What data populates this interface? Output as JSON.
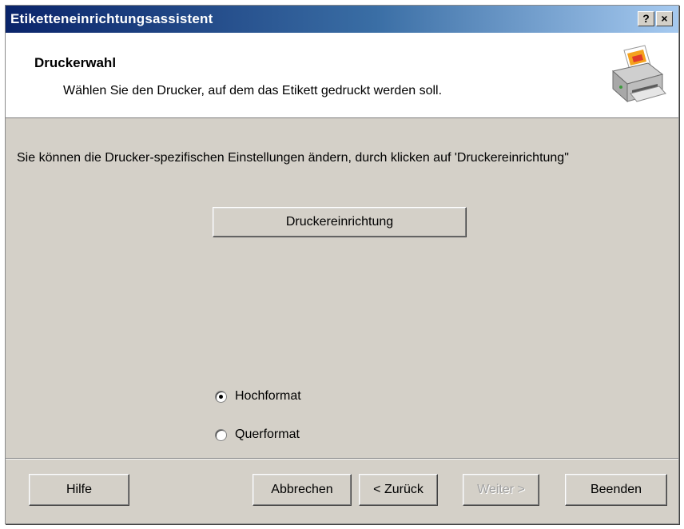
{
  "window": {
    "title": "Etiketteneinrichtungsassistent",
    "help_button": "?",
    "close_button": "×"
  },
  "header": {
    "title": "Druckerwahl",
    "description": "Wählen Sie den Drucker, auf dem das Etikett gedruckt werden soll.",
    "icon": "printer-icon"
  },
  "body": {
    "instruction": "Sie können die Drucker-spezifischen Einstellungen ändern, durch klicken auf 'Druckereinrichtung\"",
    "setup_button": "Druckereinrichtung"
  },
  "orientation": {
    "options": [
      {
        "label": "Hochformat",
        "checked": true
      },
      {
        "label": "Querformat",
        "checked": false
      }
    ]
  },
  "footer": {
    "help": "Hilfe",
    "cancel": "Abbrechen",
    "back": "< Zurück",
    "next": "Weiter >",
    "finish": "Beenden"
  },
  "colors": {
    "titlebar_start": "#0a246a",
    "titlebar_end": "#a6caf0",
    "dialog_face": "#d4d0c8",
    "disabled_text": "#a0a0a0"
  }
}
